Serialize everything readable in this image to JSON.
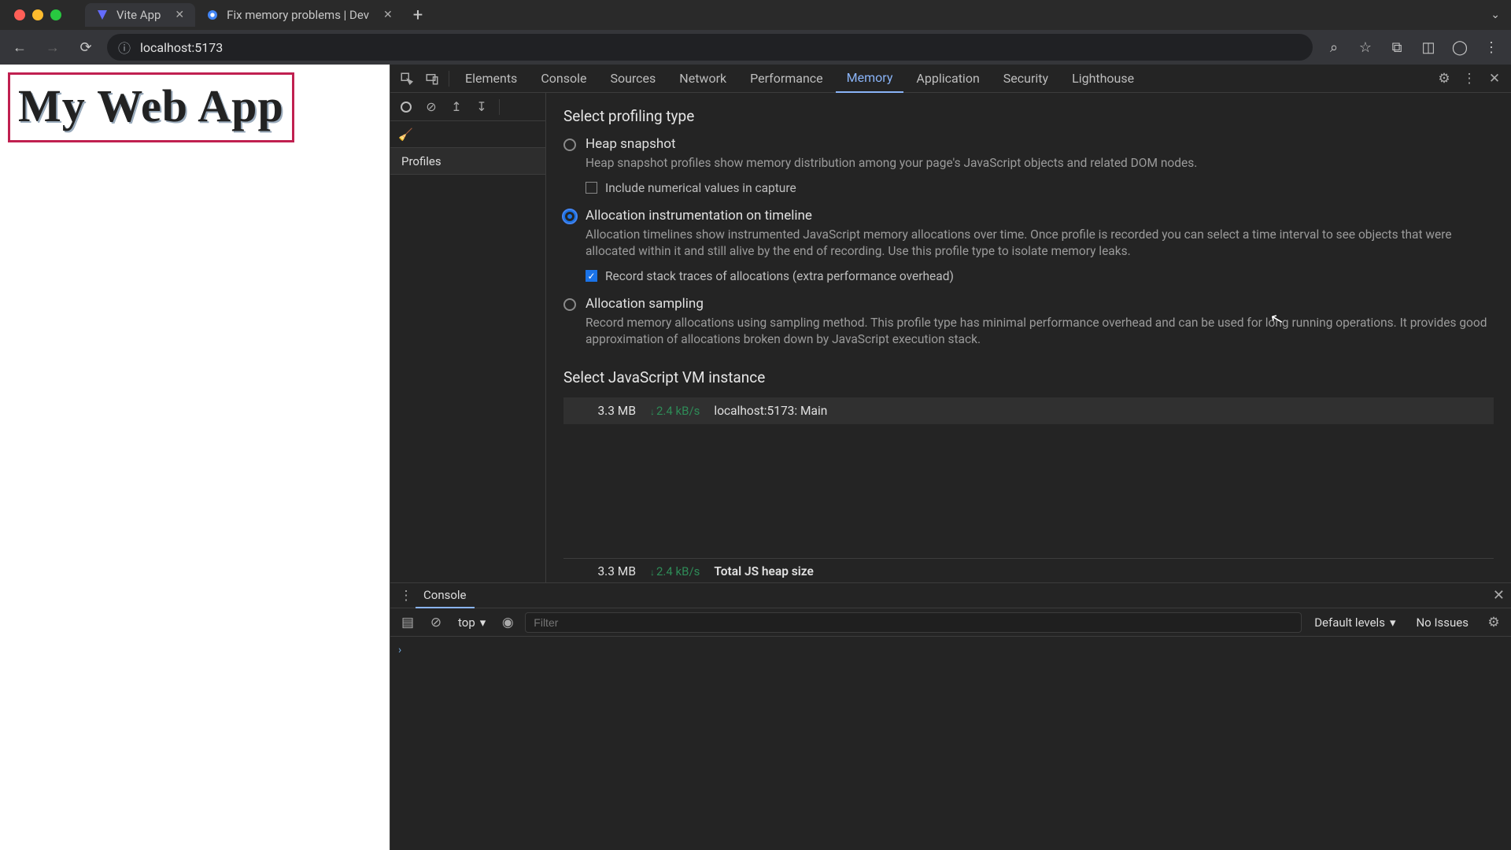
{
  "browser": {
    "tabs": [
      {
        "title": "Vite App",
        "active": true
      },
      {
        "title": "Fix memory problems | Dev",
        "active": false
      }
    ],
    "url": "localhost:5173"
  },
  "page": {
    "heading": "My Web App"
  },
  "devtools": {
    "panels": [
      "Elements",
      "Console",
      "Sources",
      "Network",
      "Performance",
      "Memory",
      "Application",
      "Security",
      "Lighthouse"
    ],
    "active_panel": "Memory",
    "profiles_label": "Profiles"
  },
  "memory": {
    "heading_type": "Select profiling type",
    "options": {
      "heap": {
        "label": "Heap snapshot",
        "desc": "Heap snapshot profiles show memory distribution among your page's JavaScript objects and related DOM nodes.",
        "checkbox_label": "Include numerical values in capture",
        "checkbox_checked": false,
        "selected": false
      },
      "timeline": {
        "label": "Allocation instrumentation on timeline",
        "desc": "Allocation timelines show instrumented JavaScript memory allocations over time. Once profile is recorded you can select a time interval to see objects that were allocated within it and still alive by the end of recording. Use this profile type to isolate memory leaks.",
        "checkbox_label": "Record stack traces of allocations (extra performance overhead)",
        "checkbox_checked": true,
        "selected": true
      },
      "sampling": {
        "label": "Allocation sampling",
        "desc": "Record memory allocations using sampling method. This profile type has minimal performance overhead and can be used for long running operations. It provides good approximation of allocations broken down by JavaScript execution stack.",
        "selected": false
      }
    },
    "heading_vm": "Select JavaScript VM instance",
    "vm": {
      "size": "3.3 MB",
      "rate": "2.4 kB/s",
      "name": "localhost:5173: Main"
    },
    "total": {
      "size": "3.3 MB",
      "rate": "2.4 kB/s",
      "label": "Total JS heap size"
    }
  },
  "console": {
    "tab_label": "Console",
    "context": "top",
    "filter_placeholder": "Filter",
    "levels_label": "Default levels",
    "issues_label": "No Issues"
  }
}
